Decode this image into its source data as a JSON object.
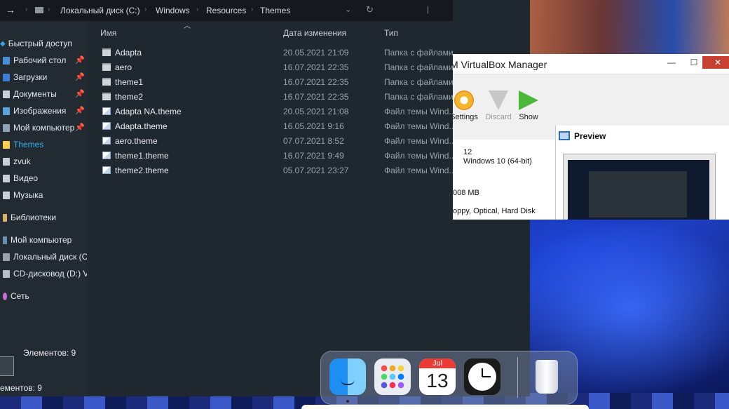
{
  "explorer": {
    "breadcrumb": [
      "Локальный диск (C:)",
      "Windows",
      "Resources",
      "Themes"
    ],
    "nav": {
      "quick_access": "Быстрый доступ",
      "items": [
        {
          "label": "Рабочий стол",
          "pinned": true
        },
        {
          "label": "Загрузки",
          "pinned": true
        },
        {
          "label": "Документы",
          "pinned": true
        },
        {
          "label": "Изображения",
          "pinned": true
        },
        {
          "label": "Мой компьютер",
          "pinned": true
        },
        {
          "label": "Themes",
          "pinned": false,
          "selected": true
        },
        {
          "label": "zvuk",
          "pinned": false
        },
        {
          "label": "Видео",
          "pinned": false
        },
        {
          "label": "Музыка",
          "pinned": false
        }
      ],
      "libraries": "Библиотеки",
      "this_pc": "Мой компьютер",
      "drive_c": "Локальный диск (C",
      "drive_d": "CD-дисковод (D:) V",
      "network": "Сеть"
    },
    "columns": {
      "name": "Имя",
      "date": "Дата изменения",
      "type": "Тип"
    },
    "files": [
      {
        "name": "Adapta",
        "date": "20.05.2021 21:09",
        "type": "Папка с файлами",
        "kind": "folder"
      },
      {
        "name": "aero",
        "date": "16.07.2021 22:35",
        "type": "Папка с файлами",
        "kind": "folder"
      },
      {
        "name": "theme1",
        "date": "16.07.2021 22:35",
        "type": "Папка с файлами",
        "kind": "folder"
      },
      {
        "name": "theme2",
        "date": "16.07.2021 22:35",
        "type": "Папка с файлами",
        "kind": "folder"
      },
      {
        "name": "Adapta NA.theme",
        "date": "20.05.2021 21:08",
        "type": "Файл темы Wind...",
        "kind": "theme"
      },
      {
        "name": "Adapta.theme",
        "date": "16.05.2021 9:16",
        "type": "Файл темы Wind...",
        "kind": "theme"
      },
      {
        "name": "aero.theme",
        "date": "07.07.2021 8:52",
        "type": "Файл темы Wind...",
        "kind": "theme"
      },
      {
        "name": "theme1.theme",
        "date": "16.07.2021 9:49",
        "type": "Файл темы Wind...",
        "kind": "theme"
      },
      {
        "name": "theme2.theme",
        "date": "05.07.2021 23:27",
        "type": "Файл темы Wind...",
        "kind": "theme"
      }
    ],
    "status_items": "Элементов: 9",
    "status_items_bottom": "ементов: 9"
  },
  "vbox": {
    "title": "M VirtualBox Manager",
    "toolbar": {
      "settings": "Settings",
      "discard": "Discard",
      "show": "Show"
    },
    "details": {
      "version": "12",
      "os": "Windows 10 (64-bit)",
      "memory": "008 MB",
      "boot": "oppy, Optical, Hard Disk"
    },
    "preview_label": "Preview"
  },
  "dock": {
    "apps": [
      "finder-icon",
      "launchpad-icon",
      "calendar-icon",
      "clock-icon",
      "trash-icon"
    ],
    "calendar": {
      "month": "Jul",
      "day": "13"
    }
  }
}
